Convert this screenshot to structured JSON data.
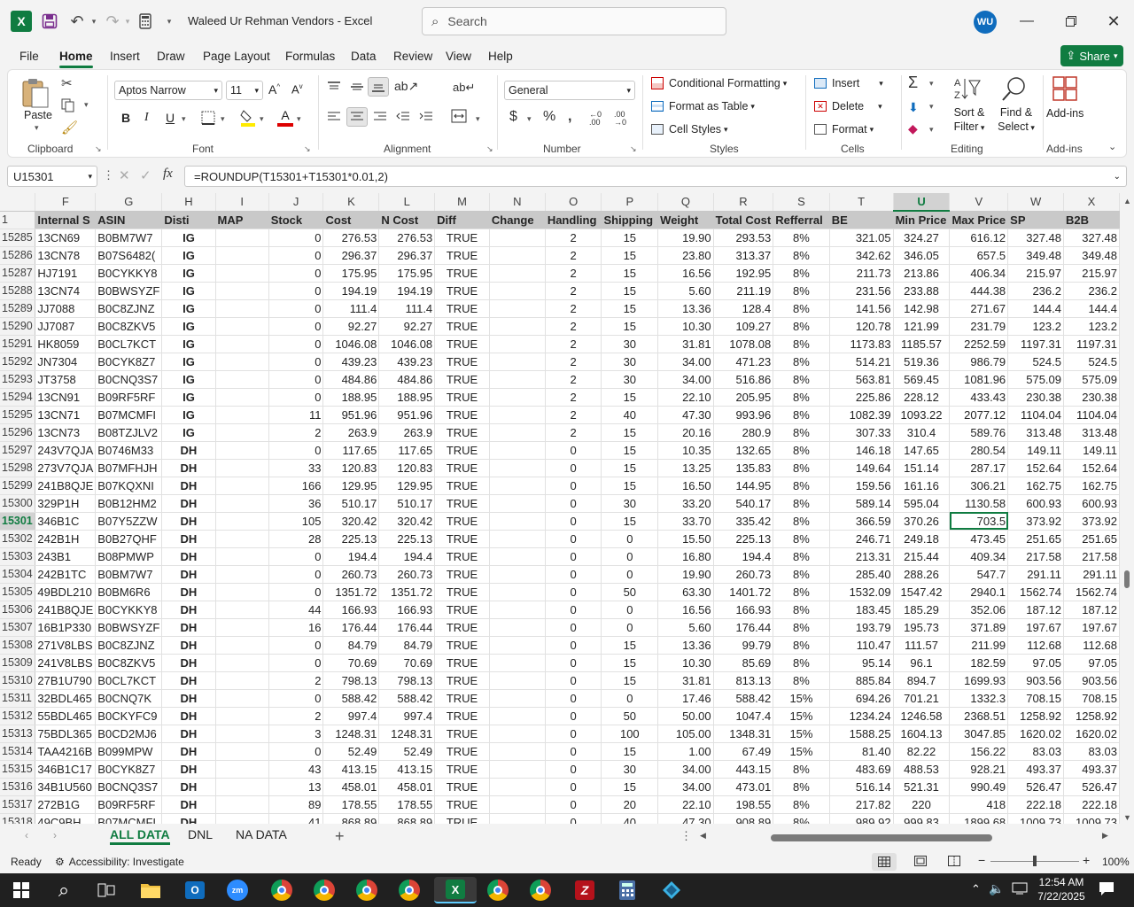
{
  "app": {
    "title": "Waleed Ur Rehman Vendors  -  Excel",
    "search_placeholder": "Search",
    "user_initials": "WU"
  },
  "tabs": [
    "File",
    "Home",
    "Insert",
    "Draw",
    "Page Layout",
    "Formulas",
    "Data",
    "Review",
    "View",
    "Help"
  ],
  "share_label": "Share",
  "ribbon": {
    "clipboard": {
      "paste": "Paste",
      "label": "Clipboard"
    },
    "font": {
      "name": "Aptos Narrow",
      "size": "11",
      "label": "Font"
    },
    "alignment": {
      "label": "Alignment"
    },
    "number": {
      "format": "General",
      "label": "Number"
    },
    "styles": {
      "cond": "Conditional Formatting",
      "table": "Format as Table",
      "cell": "Cell Styles",
      "label": "Styles"
    },
    "cells": {
      "insert": "Insert",
      "delete": "Delete",
      "format": "Format",
      "label": "Cells"
    },
    "editing": {
      "sort": "Sort &",
      "sort2": "Filter",
      "find": "Find &",
      "find2": "Select",
      "label": "Editing"
    },
    "addins": {
      "btn": "Add-ins",
      "label": "Add-ins"
    }
  },
  "formula_bar": {
    "name_box": "U15301",
    "formula": "=ROUNDUP(T15301+T15301*0.01,2)"
  },
  "columns": [
    "F",
    "G",
    "H",
    "I",
    "J",
    "K",
    "L",
    "M",
    "N",
    "O",
    "P",
    "Q",
    "R",
    "S",
    "T",
    "U",
    "V",
    "W",
    "X"
  ],
  "header_row": {
    "num": "1",
    "cells": [
      "Internal S",
      "ASIN",
      "Disti",
      "MAP",
      "Stock",
      "Cost",
      "N Cost",
      "Diff",
      "Change",
      "Handling",
      "Shipping",
      "Weight",
      "Total Cost",
      "Refferral",
      "BE",
      "Min Price",
      "Max Price",
      "SP",
      "B2B"
    ]
  },
  "rows": [
    [
      "15285",
      "13CN69",
      "B0BM7W7",
      "IG",
      "",
      "0",
      "276.53",
      "276.53",
      "TRUE",
      "",
      "2",
      "15",
      "19.90",
      "293.53",
      "8%",
      "321.05",
      "324.27",
      "616.12",
      "327.48",
      "327.48"
    ],
    [
      "15286",
      "13CN78",
      "B07S6482(",
      "IG",
      "",
      "0",
      "296.37",
      "296.37",
      "TRUE",
      "",
      "2",
      "15",
      "23.80",
      "313.37",
      "8%",
      "342.62",
      "346.05",
      "657.5",
      "349.48",
      "349.48"
    ],
    [
      "15287",
      "HJ7191",
      "B0CYKKY8",
      "IG",
      "",
      "0",
      "175.95",
      "175.95",
      "TRUE",
      "",
      "2",
      "15",
      "16.56",
      "192.95",
      "8%",
      "211.73",
      "213.86",
      "406.34",
      "215.97",
      "215.97"
    ],
    [
      "15288",
      "13CN74",
      "B0BWSYZF",
      "IG",
      "",
      "0",
      "194.19",
      "194.19",
      "TRUE",
      "",
      "2",
      "15",
      "5.60",
      "211.19",
      "8%",
      "231.56",
      "233.88",
      "444.38",
      "236.2",
      "236.2"
    ],
    [
      "15289",
      "JJ7088",
      "B0C8ZJNZ",
      "IG",
      "",
      "0",
      "111.4",
      "111.4",
      "TRUE",
      "",
      "2",
      "15",
      "13.36",
      "128.4",
      "8%",
      "141.56",
      "142.98",
      "271.67",
      "144.4",
      "144.4"
    ],
    [
      "15290",
      "JJ7087",
      "B0C8ZKV5",
      "IG",
      "",
      "0",
      "92.27",
      "92.27",
      "TRUE",
      "",
      "2",
      "15",
      "10.30",
      "109.27",
      "8%",
      "120.78",
      "121.99",
      "231.79",
      "123.2",
      "123.2"
    ],
    [
      "15291",
      "HK8059",
      "B0CL7KCT",
      "IG",
      "",
      "0",
      "1046.08",
      "1046.08",
      "TRUE",
      "",
      "2",
      "30",
      "31.81",
      "1078.08",
      "8%",
      "1173.83",
      "1185.57",
      "2252.59",
      "1197.31",
      "1197.31"
    ],
    [
      "15292",
      "JN7304",
      "B0CYK8Z7",
      "IG",
      "",
      "0",
      "439.23",
      "439.23",
      "TRUE",
      "",
      "2",
      "30",
      "34.00",
      "471.23",
      "8%",
      "514.21",
      "519.36",
      "986.79",
      "524.5",
      "524.5"
    ],
    [
      "15293",
      "JT3758",
      "B0CNQ3S7",
      "IG",
      "",
      "0",
      "484.86",
      "484.86",
      "TRUE",
      "",
      "2",
      "30",
      "34.00",
      "516.86",
      "8%",
      "563.81",
      "569.45",
      "1081.96",
      "575.09",
      "575.09"
    ],
    [
      "15294",
      "13CN91",
      "B09RF5RF",
      "IG",
      "",
      "0",
      "188.95",
      "188.95",
      "TRUE",
      "",
      "2",
      "15",
      "22.10",
      "205.95",
      "8%",
      "225.86",
      "228.12",
      "433.43",
      "230.38",
      "230.38"
    ],
    [
      "15295",
      "13CN71",
      "B07MCMFI",
      "IG",
      "",
      "11",
      "951.96",
      "951.96",
      "TRUE",
      "",
      "2",
      "40",
      "47.30",
      "993.96",
      "8%",
      "1082.39",
      "1093.22",
      "2077.12",
      "1104.04",
      "1104.04"
    ],
    [
      "15296",
      "13CN73",
      "B08TZJLV2",
      "IG",
      "",
      "2",
      "263.9",
      "263.9",
      "TRUE",
      "",
      "2",
      "15",
      "20.16",
      "280.9",
      "8%",
      "307.33",
      "310.4",
      "589.76",
      "313.48",
      "313.48"
    ],
    [
      "15297",
      "243V7QJA",
      "B0746M33",
      "DH",
      "",
      "0",
      "117.65",
      "117.65",
      "TRUE",
      "",
      "0",
      "15",
      "10.35",
      "132.65",
      "8%",
      "146.18",
      "147.65",
      "280.54",
      "149.11",
      "149.11"
    ],
    [
      "15298",
      "273V7QJA",
      "B07MFHJH",
      "DH",
      "",
      "33",
      "120.83",
      "120.83",
      "TRUE",
      "",
      "0",
      "15",
      "13.25",
      "135.83",
      "8%",
      "149.64",
      "151.14",
      "287.17",
      "152.64",
      "152.64"
    ],
    [
      "15299",
      "241B8QJE",
      "B07KQXNI",
      "DH",
      "",
      "166",
      "129.95",
      "129.95",
      "TRUE",
      "",
      "0",
      "15",
      "16.50",
      "144.95",
      "8%",
      "159.56",
      "161.16",
      "306.21",
      "162.75",
      "162.75"
    ],
    [
      "15300",
      "329P1H",
      "B0B12HM2",
      "DH",
      "",
      "36",
      "510.17",
      "510.17",
      "TRUE",
      "",
      "0",
      "30",
      "33.20",
      "540.17",
      "8%",
      "589.14",
      "595.04",
      "1130.58",
      "600.93",
      "600.93"
    ],
    [
      "15301",
      "346B1C",
      "B07Y5ZZW",
      "DH",
      "",
      "105",
      "320.42",
      "320.42",
      "TRUE",
      "",
      "0",
      "15",
      "33.70",
      "335.42",
      "8%",
      "366.59",
      "370.26",
      "703.5",
      "373.92",
      "373.92"
    ],
    [
      "15302",
      "242B1H",
      "B0B27QHF",
      "DH",
      "",
      "28",
      "225.13",
      "225.13",
      "TRUE",
      "",
      "0",
      "0",
      "15.50",
      "225.13",
      "8%",
      "246.71",
      "249.18",
      "473.45",
      "251.65",
      "251.65"
    ],
    [
      "15303",
      "243B1",
      "B08PMWP",
      "DH",
      "",
      "0",
      "194.4",
      "194.4",
      "TRUE",
      "",
      "0",
      "0",
      "16.80",
      "194.4",
      "8%",
      "213.31",
      "215.44",
      "409.34",
      "217.58",
      "217.58"
    ],
    [
      "15304",
      "242B1TC",
      "B0BM7W7",
      "DH",
      "",
      "0",
      "260.73",
      "260.73",
      "TRUE",
      "",
      "0",
      "0",
      "19.90",
      "260.73",
      "8%",
      "285.40",
      "288.26",
      "547.7",
      "291.11",
      "291.11"
    ],
    [
      "15305",
      "49BDL210",
      "B0BM6R6",
      "DH",
      "",
      "0",
      "1351.72",
      "1351.72",
      "TRUE",
      "",
      "0",
      "50",
      "63.30",
      "1401.72",
      "8%",
      "1532.09",
      "1547.42",
      "2940.1",
      "1562.74",
      "1562.74"
    ],
    [
      "15306",
      "241B8QJE",
      "B0CYKKY8",
      "DH",
      "",
      "44",
      "166.93",
      "166.93",
      "TRUE",
      "",
      "0",
      "0",
      "16.56",
      "166.93",
      "8%",
      "183.45",
      "185.29",
      "352.06",
      "187.12",
      "187.12"
    ],
    [
      "15307",
      "16B1P330",
      "B0BWSYZF",
      "DH",
      "",
      "16",
      "176.44",
      "176.44",
      "TRUE",
      "",
      "0",
      "0",
      "5.60",
      "176.44",
      "8%",
      "193.79",
      "195.73",
      "371.89",
      "197.67",
      "197.67"
    ],
    [
      "15308",
      "271V8LBS",
      "B0C8ZJNZ",
      "DH",
      "",
      "0",
      "84.79",
      "84.79",
      "TRUE",
      "",
      "0",
      "15",
      "13.36",
      "99.79",
      "8%",
      "110.47",
      "111.57",
      "211.99",
      "112.68",
      "112.68"
    ],
    [
      "15309",
      "241V8LBS",
      "B0C8ZKV5",
      "DH",
      "",
      "0",
      "70.69",
      "70.69",
      "TRUE",
      "",
      "0",
      "15",
      "10.30",
      "85.69",
      "8%",
      "95.14",
      "96.1",
      "182.59",
      "97.05",
      "97.05"
    ],
    [
      "15310",
      "27B1U790",
      "B0CL7KCT",
      "DH",
      "",
      "2",
      "798.13",
      "798.13",
      "TRUE",
      "",
      "0",
      "15",
      "31.81",
      "813.13",
      "8%",
      "885.84",
      "894.7",
      "1699.93",
      "903.56",
      "903.56"
    ],
    [
      "15311",
      "32BDL465",
      "B0CNQ7K",
      "DH",
      "",
      "0",
      "588.42",
      "588.42",
      "TRUE",
      "",
      "0",
      "0",
      "17.46",
      "588.42",
      "15%",
      "694.26",
      "701.21",
      "1332.3",
      "708.15",
      "708.15"
    ],
    [
      "15312",
      "55BDL465",
      "B0CKYFC9",
      "DH",
      "",
      "2",
      "997.4",
      "997.4",
      "TRUE",
      "",
      "0",
      "50",
      "50.00",
      "1047.4",
      "15%",
      "1234.24",
      "1246.58",
      "2368.51",
      "1258.92",
      "1258.92"
    ],
    [
      "15313",
      "75BDL365",
      "B0CD2MJ6",
      "DH",
      "",
      "3",
      "1248.31",
      "1248.31",
      "TRUE",
      "",
      "0",
      "100",
      "105.00",
      "1348.31",
      "15%",
      "1588.25",
      "1604.13",
      "3047.85",
      "1620.02",
      "1620.02"
    ],
    [
      "15314",
      "TAA4216B",
      "B099MPW",
      "DH",
      "",
      "0",
      "52.49",
      "52.49",
      "TRUE",
      "",
      "0",
      "15",
      "1.00",
      "67.49",
      "15%",
      "81.40",
      "82.22",
      "156.22",
      "83.03",
      "83.03"
    ],
    [
      "15315",
      "346B1C17",
      "B0CYK8Z7",
      "DH",
      "",
      "43",
      "413.15",
      "413.15",
      "TRUE",
      "",
      "0",
      "30",
      "34.00",
      "443.15",
      "8%",
      "483.69",
      "488.53",
      "928.21",
      "493.37",
      "493.37"
    ],
    [
      "15316",
      "34B1U560",
      "B0CNQ3S7",
      "DH",
      "",
      "13",
      "458.01",
      "458.01",
      "TRUE",
      "",
      "0",
      "15",
      "34.00",
      "473.01",
      "8%",
      "516.14",
      "521.31",
      "990.49",
      "526.47",
      "526.47"
    ],
    [
      "15317",
      "272B1G",
      "B09RF5RF",
      "DH",
      "",
      "89",
      "178.55",
      "178.55",
      "TRUE",
      "",
      "0",
      "20",
      "22.10",
      "198.55",
      "8%",
      "217.82",
      "220",
      "418",
      "222.18",
      "222.18"
    ],
    [
      "15318",
      "49C9BH",
      "B07MCMFI",
      "DH",
      "",
      "41",
      "868.89",
      "868.89",
      "TRUE",
      "",
      "0",
      "40",
      "47.30",
      "908.89",
      "8%",
      "989.92",
      "999.83",
      "1899.68",
      "1009.73",
      "1009.73"
    ]
  ],
  "sheets": [
    "ALL DATA",
    "DNL",
    "NA DATA"
  ],
  "status": {
    "ready": "Ready",
    "accessibility": "Accessibility: Investigate",
    "zoom": "100%"
  },
  "clock": {
    "time": "12:54 AM",
    "date": "7/22/2025"
  },
  "colors": {
    "accent": "#107c41",
    "header_fill": "#c9c9c9"
  }
}
